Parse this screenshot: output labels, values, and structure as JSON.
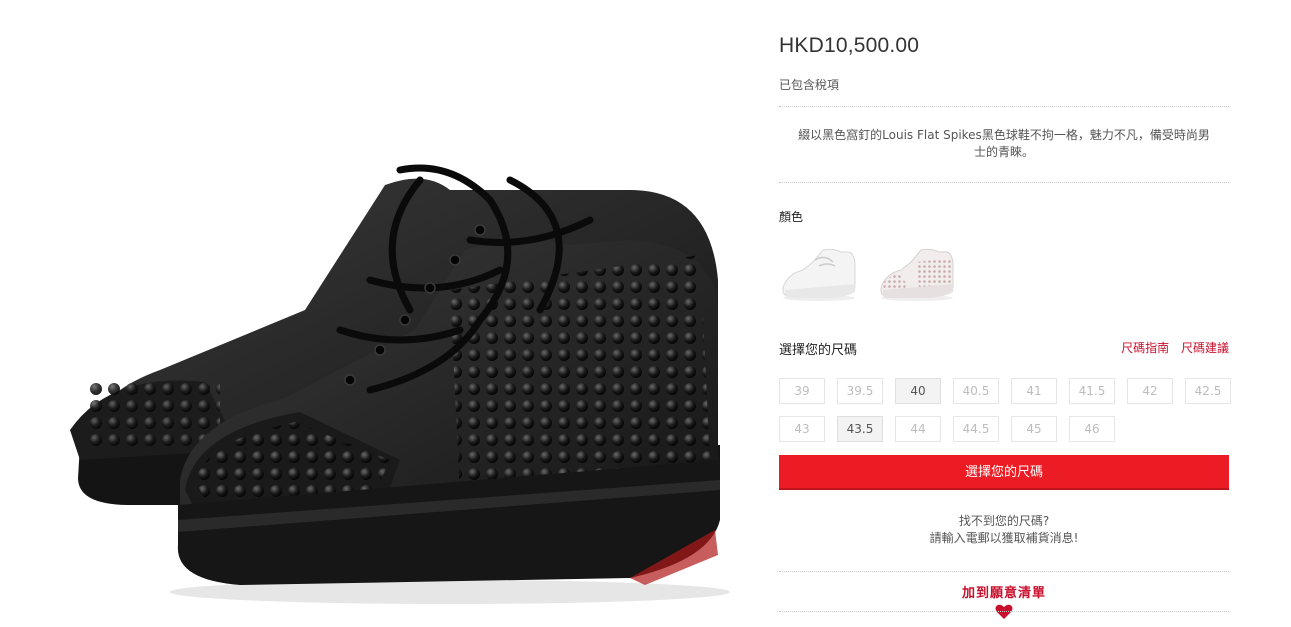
{
  "product": {
    "price": "HKD10,500.00",
    "tax_note": "已包含稅項",
    "description": "綴以黑色窩釘的Louis Flat Spikes黑色球鞋不拘一格，魅力不凡，備受時尚男士的青睞。"
  },
  "color": {
    "label": "顏色"
  },
  "size": {
    "label": "選擇您的尺碼",
    "guide_link": "尺碼指南",
    "advice_link": "尺碼建議",
    "options": [
      {
        "label": "39",
        "available": false
      },
      {
        "label": "39.5",
        "available": false
      },
      {
        "label": "40",
        "available": true
      },
      {
        "label": "40.5",
        "available": false
      },
      {
        "label": "41",
        "available": false
      },
      {
        "label": "41.5",
        "available": false
      },
      {
        "label": "42",
        "available": false
      },
      {
        "label": "42.5",
        "available": false
      },
      {
        "label": "43",
        "available": false
      },
      {
        "label": "43.5",
        "available": true
      },
      {
        "label": "44",
        "available": false
      },
      {
        "label": "44.5",
        "available": false
      },
      {
        "label": "45",
        "available": false
      },
      {
        "label": "46",
        "available": false
      }
    ],
    "select_button": "選擇您的尺碼"
  },
  "notify": {
    "line1": "找不到您的尺碼?",
    "line2": "請輸入電郵以獲取補貨消息!"
  },
  "wishlist": {
    "label": "加到願意清單",
    "icon": "heart-icon"
  },
  "colors": {
    "accent": "#ec1c24",
    "link": "#c8102e"
  }
}
